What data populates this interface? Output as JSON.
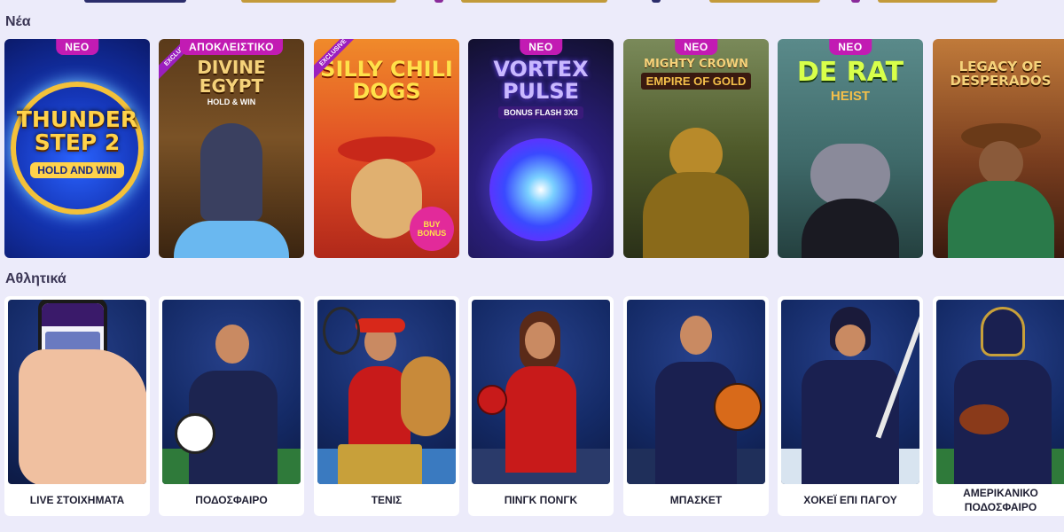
{
  "sections": {
    "new": {
      "title": "Νέα"
    },
    "sports": {
      "title": "Αθλητικά"
    }
  },
  "games": [
    {
      "title": "Thunder Step 2",
      "subtitle": "Hold and Win",
      "badge": "ΝΕΟ",
      "exclusive": "",
      "color": "#1536b8"
    },
    {
      "title": "Divine Egypt",
      "subtitle": "Hold & Win",
      "badge": "ΑΠΟΚΛΕΙΣΤΙΚΟ",
      "exclusive": "Exclusive",
      "color": "#6a4420"
    },
    {
      "title": "Silly Chili Dogs",
      "subtitle": "Buy Bonus",
      "badge": "",
      "exclusive": "Exclusive",
      "color": "#e04a24"
    },
    {
      "title": "Vortex Pulse",
      "subtitle": "Bonus Flash 3x3",
      "badge": "ΝΕΟ",
      "exclusive": "",
      "color": "#1a1640"
    },
    {
      "title": "Mighty Crown",
      "subtitle": "Empire of Gold",
      "badge": "ΝΕΟ",
      "exclusive": "",
      "color": "#4f5a2a"
    },
    {
      "title": "De Rat",
      "subtitle": "Heist",
      "badge": "ΝΕΟ",
      "exclusive": "",
      "color": "#3f6a6a"
    },
    {
      "title": "Legacy of Desperados",
      "subtitle": "",
      "badge": "",
      "exclusive": "",
      "color": "#7a3e1f"
    }
  ],
  "sports": [
    {
      "label": "LIVE ΣΤΟΙΧΗΜΑΤΑ",
      "icon": "phone-icon"
    },
    {
      "label": "ΠΟΔΟΣΦΑΙΡΟ",
      "icon": "football-icon"
    },
    {
      "label": "ΤΕΝΙΣ",
      "icon": "tennis-icon"
    },
    {
      "label": "ΠΙΝΓΚ ΠΟΝΓΚ",
      "icon": "table-tennis-icon"
    },
    {
      "label": "ΜΠΑΣΚΕΤ",
      "icon": "basketball-icon"
    },
    {
      "label": "ΧΟΚΕΪ ΕΠΙ ΠΑΓΟΥ",
      "icon": "hockey-icon"
    },
    {
      "label": "ΑΜΕΡΙΚΑΝΙΚΟ ΠΟΔΟΣΦΑΙΡΟ",
      "icon": "american-football-icon"
    }
  ]
}
